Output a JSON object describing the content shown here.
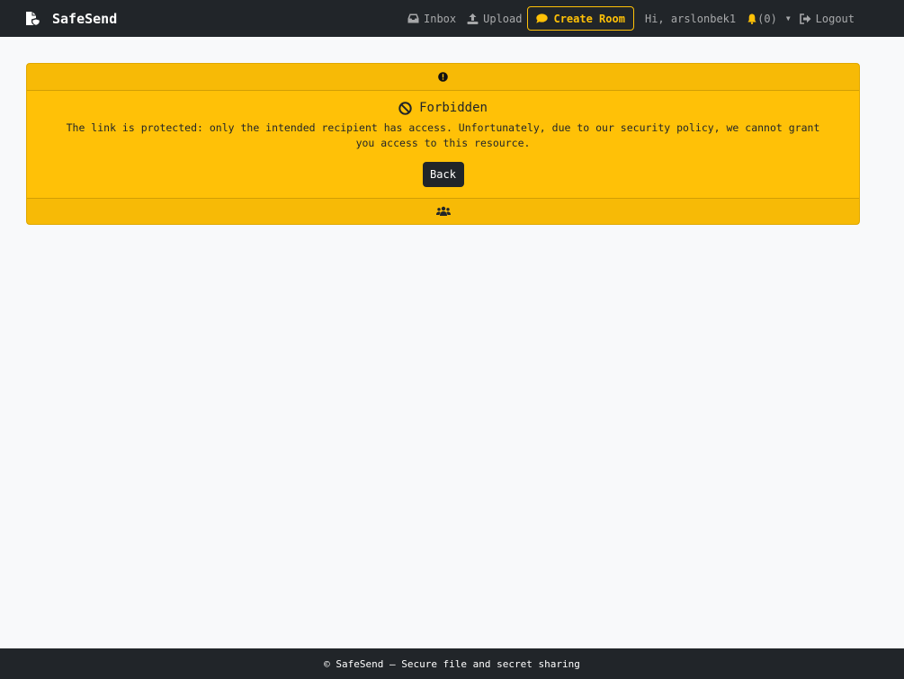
{
  "navbar": {
    "brand": "SafeSend",
    "inbox": "Inbox",
    "upload": "Upload",
    "create_room": "Create Room",
    "greeting": "Hi, arslonbek1",
    "notifications": "(0)",
    "logout": "Logout"
  },
  "alert": {
    "title": "Forbidden",
    "message": "The link is protected: only the intended recipient has access. Unfortunately, due to our security policy, we cannot grant you access to this resource.",
    "back_label": "Back"
  },
  "footer": {
    "text": "© SafeSend — Secure file and secret sharing"
  },
  "colors": {
    "navbar_bg": "#212529",
    "accent": "#ffc107",
    "page_bg": "#f8f9fa"
  },
  "icons": {
    "brand": "file-shield-icon",
    "inbox": "inbox-icon",
    "upload": "upload-icon",
    "create_room": "chat-bubble-icon",
    "notifications": "bell-icon",
    "dropdown": "caret-down-icon",
    "logout": "logout-icon",
    "header": "exclamation-circle-icon",
    "title": "ban-icon",
    "footer": "users-icon"
  }
}
